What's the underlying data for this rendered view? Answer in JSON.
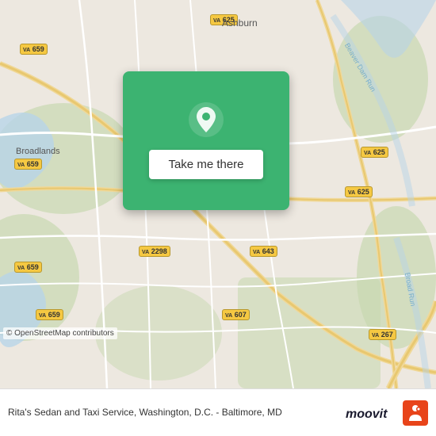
{
  "map": {
    "background_color": "#e8e0d8",
    "copyright": "© OpenStreetMap contributors",
    "location_label": "Ashburn"
  },
  "action_card": {
    "button_label": "Take me there"
  },
  "footer": {
    "description": "Rita's Sedan and Taxi Service, Washington, D.C. - Baltimore, MD",
    "logo_text": "moovit"
  },
  "road_badges": [
    {
      "id": "va659-top-left",
      "label": "VA 659",
      "top": "55",
      "left": "25"
    },
    {
      "id": "va625-top-mid",
      "label": "VA 625",
      "top": "18",
      "left": "270"
    },
    {
      "id": "va625-right",
      "label": "VA 625",
      "top": "185",
      "left": "460"
    },
    {
      "id": "va625-mid-right",
      "label": "VA 625",
      "top": "235",
      "left": "430"
    },
    {
      "id": "va659-mid",
      "label": "VA 659",
      "top": "200",
      "left": "25"
    },
    {
      "id": "va659-lower",
      "label": "VA 659",
      "top": "330",
      "left": "25"
    },
    {
      "id": "va659-bottom",
      "label": "VA 659",
      "top": "390",
      "left": "55"
    },
    {
      "id": "va2298",
      "label": "VA 2298",
      "top": "310",
      "left": "185"
    },
    {
      "id": "va643",
      "label": "VA 643",
      "top": "310",
      "left": "320"
    },
    {
      "id": "va607",
      "label": "VA 607",
      "top": "390",
      "left": "290"
    },
    {
      "id": "va267",
      "label": "VA 267",
      "top": "415",
      "left": "470"
    }
  ],
  "place_labels": [
    {
      "id": "ashburn",
      "text": "Ashburn",
      "top": "22",
      "left": "280"
    },
    {
      "id": "broadlands",
      "text": "Broadlands",
      "top": "185",
      "left": "55"
    }
  ]
}
